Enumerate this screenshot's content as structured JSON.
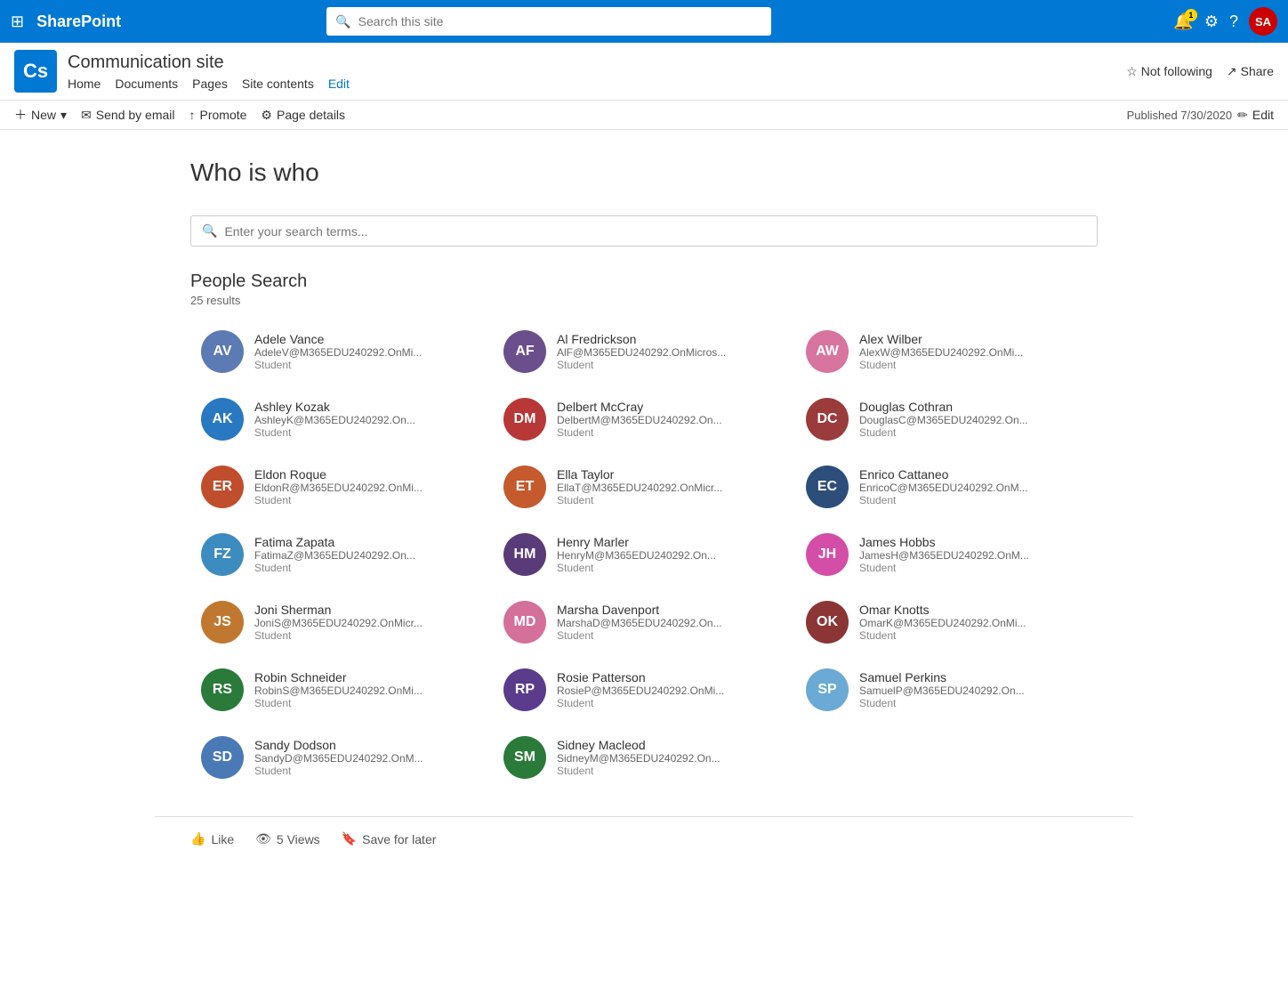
{
  "topNav": {
    "logo": "SharePoint",
    "searchPlaceholder": "Search this site",
    "icons": {
      "notifications": "🔔",
      "settings": "⚙",
      "help": "?",
      "badge": "1"
    },
    "userInitials": "SA"
  },
  "siteHeader": {
    "logoText": "Cs",
    "siteTitle": "Communication site",
    "nav": [
      {
        "label": "Home",
        "href": "#"
      },
      {
        "label": "Documents",
        "href": "#"
      },
      {
        "label": "Pages",
        "href": "#"
      },
      {
        "label": "Site contents",
        "href": "#"
      },
      {
        "label": "Edit",
        "href": "#",
        "highlight": true
      }
    ],
    "notFollowing": "Not following",
    "share": "Share"
  },
  "toolbar": {
    "new": "New",
    "sendByEmail": "Send by email",
    "promote": "Promote",
    "pageDetails": "Page details",
    "publishedLabel": "Published 7/30/2020",
    "editLabel": "Edit"
  },
  "page": {
    "title": "Who is who",
    "searchPlaceholder": "Enter your search terms...",
    "peopleSearch": {
      "title": "People Search",
      "resultCount": "25 results"
    }
  },
  "people": [
    {
      "initials": "AV",
      "name": "Adele Vance",
      "email": "AdeleV@M365EDU240292.OnMi...",
      "role": "Student",
      "color": "#5c7ab3"
    },
    {
      "initials": "AF",
      "name": "Al Fredrickson",
      "email": "AlF@M365EDU240292.OnMicros...",
      "role": "Student",
      "color": "#6b4f8c"
    },
    {
      "initials": "AW",
      "name": "Alex Wilber",
      "email": "AlexW@M365EDU240292.OnMi...",
      "role": "Student",
      "color": "#d874a0"
    },
    {
      "initials": "AK",
      "name": "Ashley Kozak",
      "email": "AshleyK@M365EDU240292.On...",
      "role": "Student",
      "color": "#2878c2"
    },
    {
      "initials": "DM",
      "name": "Delbert McCray",
      "email": "DelbertM@M365EDU240292.On...",
      "role": "Student",
      "color": "#b83737"
    },
    {
      "initials": "DC",
      "name": "Douglas Cothran",
      "email": "DouglasC@M365EDU240292.On...",
      "role": "Student",
      "color": "#9c3b3b"
    },
    {
      "initials": "ER",
      "name": "Eldon Roque",
      "email": "EldonR@M365EDU240292.OnMi...",
      "role": "Student",
      "color": "#c04e2c"
    },
    {
      "initials": "ET",
      "name": "Ella Taylor",
      "email": "EllaT@M365EDU240292.OnMicr...",
      "role": "Student",
      "color": "#c55a2c"
    },
    {
      "initials": "EC",
      "name": "Enrico Cattaneo",
      "email": "EnricoC@M365EDU240292.OnM...",
      "role": "Student",
      "color": "#2d4e7a"
    },
    {
      "initials": "FZ",
      "name": "Fatima Zapata",
      "email": "FatimaZ@M365EDU240292.On...",
      "role": "Student",
      "color": "#3d8cbf"
    },
    {
      "initials": "HM",
      "name": "Henry Marler",
      "email": "HenryM@M365EDU240292.On...",
      "role": "Student",
      "color": "#5a3b7a"
    },
    {
      "initials": "JH",
      "name": "James Hobbs",
      "email": "JamesH@M365EDU240292.OnM...",
      "role": "Student",
      "color": "#d44ea8"
    },
    {
      "initials": "JS",
      "name": "Joni Sherman",
      "email": "JoniS@M365EDU240292.OnMicr...",
      "role": "Student",
      "color": "#c07830"
    },
    {
      "initials": "MD",
      "name": "Marsha Davenport",
      "email": "MarshaD@M365EDU240292.On...",
      "role": "Student",
      "color": "#d4709a"
    },
    {
      "initials": "OK",
      "name": "Omar Knotts",
      "email": "OmarK@M365EDU240292.OnMi...",
      "role": "Student",
      "color": "#8c3535"
    },
    {
      "initials": "RS",
      "name": "Robin Schneider",
      "email": "RobinS@M365EDU240292.OnMi...",
      "role": "Student",
      "color": "#2a7a3a"
    },
    {
      "initials": "RP",
      "name": "Rosie Patterson",
      "email": "RosieP@M365EDU240292.OnMi...",
      "role": "Student",
      "color": "#5a3b8c"
    },
    {
      "initials": "SP",
      "name": "Samuel Perkins",
      "email": "SamuelP@M365EDU240292.On...",
      "role": "Student",
      "color": "#6aaad4"
    },
    {
      "initials": "SD",
      "name": "Sandy Dodson",
      "email": "SandyD@M365EDU240292.OnM...",
      "role": "Student",
      "color": "#4a7ab5"
    },
    {
      "initials": "SM",
      "name": "Sidney Macleod",
      "email": "SidneyM@M365EDU240292.On...",
      "role": "Student",
      "color": "#2a7a3a"
    }
  ],
  "footer": {
    "like": "Like",
    "views": "5 Views",
    "saveForLater": "Save for later"
  }
}
